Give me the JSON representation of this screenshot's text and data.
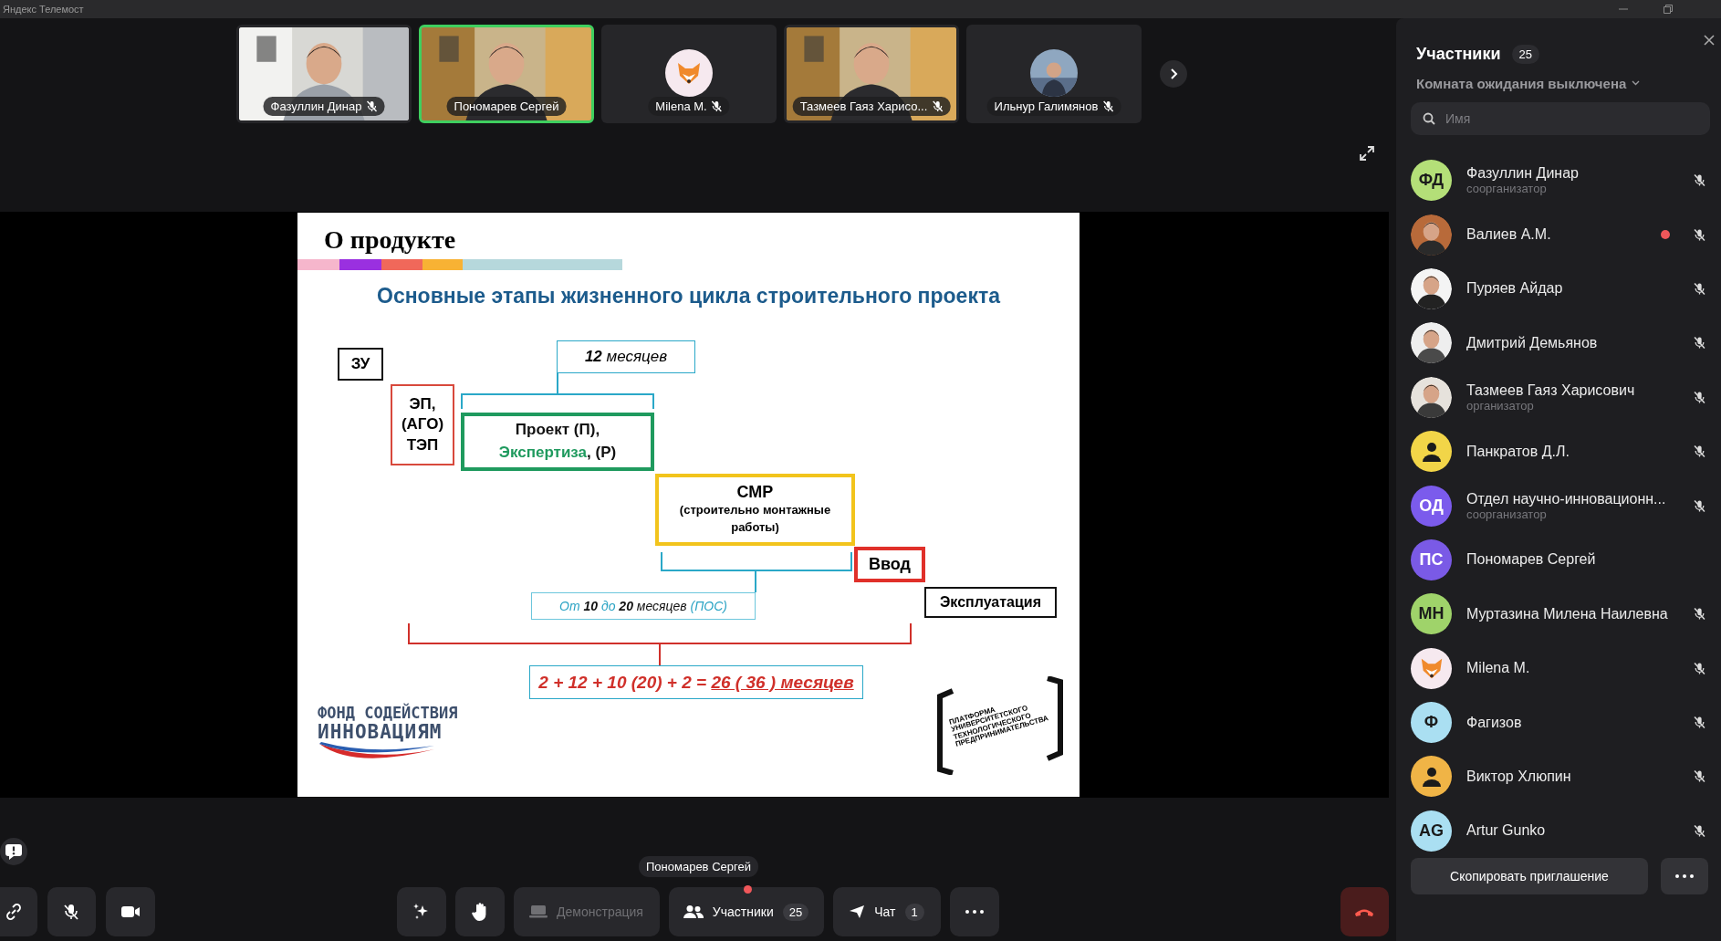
{
  "app_title": "Яндекс Телемост",
  "thumbnails": [
    {
      "name": "Фазуллин Динар",
      "kind": "video",
      "muted": true,
      "speaking": false
    },
    {
      "name": "Пономарев Сергей",
      "kind": "video",
      "muted": false,
      "speaking": true
    },
    {
      "name": "Milena M.",
      "kind": "emoji",
      "muted": true,
      "speaking": false
    },
    {
      "name": "Тазмеев Гаяз Харисо...",
      "kind": "video",
      "muted": true,
      "speaking": false
    },
    {
      "name": "Ильнур Галимянов",
      "muted": true,
      "speaking": false
    }
  ],
  "slide": {
    "title": "О продукте",
    "subtitle": "Основные этапы жизненного цикла строительного проекта",
    "zu": "ЗУ",
    "ep": "ЭП,\n(АГО)\nТЭП",
    "months": "**12** месяцев",
    "project": [
      {
        "text": "Проект (П),\n",
        "kind": "plain"
      },
      {
        "text": "Экспертиза",
        "kind": "accent"
      },
      {
        "text": ", (Р)",
        "kind": "plain"
      }
    ],
    "smr": {
      "title": "СМР",
      "note": "(строительно монтажные работы)"
    },
    "input": "Ввод",
    "operation": "Эксплуатация",
    "duration": [
      {
        "text": "От ",
        "kind": "accent"
      },
      {
        "text": "10",
        "kind": "bold"
      },
      {
        "text": " до ",
        "kind": "accent"
      },
      {
        "text": "20",
        "kind": "bold"
      },
      {
        "text": " месяцев ",
        "kind": "plain"
      },
      {
        "text": "(ПОС)",
        "kind": "accent"
      }
    ],
    "formula": [
      {
        "text": "2 + 12 + 10 (20) + 2 = ",
        "kind": "plain"
      },
      {
        "text": "26 ( 36 ) месяцев",
        "kind": "underline"
      }
    ],
    "fund_logo": [
      "ФОНД СОДЕЙСТВИЯ",
      "ИННОВАЦИЯМ"
    ],
    "platform_logo": [
      "ПЛАТФОРМА",
      "УНИВЕРСИТЕТСКОГО",
      "ТЕХНОЛОГИЧЕСКОГО",
      "ПРЕДПРИНИМАТЕЛЬСТВА"
    ]
  },
  "speaker_label": "Пономарев Сергей",
  "toolbar": {
    "demo": {
      "label": "Демонстрация",
      "disabled": true
    },
    "participants": {
      "label": "Участники",
      "count": "25",
      "notification": true
    },
    "chat": {
      "label": "Чат",
      "count": "1"
    }
  },
  "panel": {
    "title": "Участники",
    "count": "25",
    "waiting_room": "Комната ожидания выключена",
    "search": {
      "placeholder": "Имя"
    },
    "participants": [
      {
        "name": "Фазуллин Динар",
        "role": "соорганизатор",
        "avatar": {
          "kind": "initials",
          "text": "ФД",
          "color": "#b4df78"
        },
        "muted": true,
        "dot": false
      },
      {
        "name": "Валиев А.М.",
        "muted": true,
        "dot": true
      },
      {
        "name": "Пуряев Айдар",
        "muted": true,
        "dot": false
      },
      {
        "name": "Дмитрий Демьянов",
        "muted": true,
        "dot": false
      },
      {
        "name": "Тазмеев Гаяз Харисович",
        "role": "организатор",
        "muted": true,
        "dot": false
      },
      {
        "name": "Панкратов Д.Л.",
        "avatar": {
          "kind": "silhouette",
          "color": "#f2d548"
        },
        "muted": true,
        "dot": false
      },
      {
        "name": "Отдел научно-инновационн...",
        "role": "соорганизатор",
        "avatar": {
          "kind": "initials",
          "text": "ОД",
          "color": "#7b5bec"
        },
        "muted": true,
        "dot": false
      },
      {
        "name": "Пономарев Сергей",
        "avatar": {
          "kind": "initials",
          "text": "ПС",
          "color": "#7a5ae6"
        },
        "muted": false,
        "dot": false
      },
      {
        "name": "Муртазина Милена Наилевна",
        "avatar": {
          "kind": "initials",
          "text": "МН",
          "color": "#9fd36a"
        },
        "muted": true,
        "dot": false
      },
      {
        "name": "Milena M.",
        "avatar": {
          "kind": "emoji"
        },
        "muted": true,
        "dot": false
      },
      {
        "name": "Фагизов",
        "avatar": {
          "kind": "initials",
          "text": "Ф",
          "color": "#aadff2"
        },
        "muted": true,
        "dot": false
      },
      {
        "name": "Виктор Хлюпин",
        "avatar": {
          "kind": "silhouette",
          "color": "#f0b446"
        },
        "muted": true,
        "dot": false
      },
      {
        "name": "Artur Gunko",
        "avatar": {
          "kind": "initials",
          "text": "AG",
          "color": "#aadff2"
        },
        "muted": true,
        "dot": false
      }
    ],
    "copy_invite": "Скопировать приглашение"
  }
}
